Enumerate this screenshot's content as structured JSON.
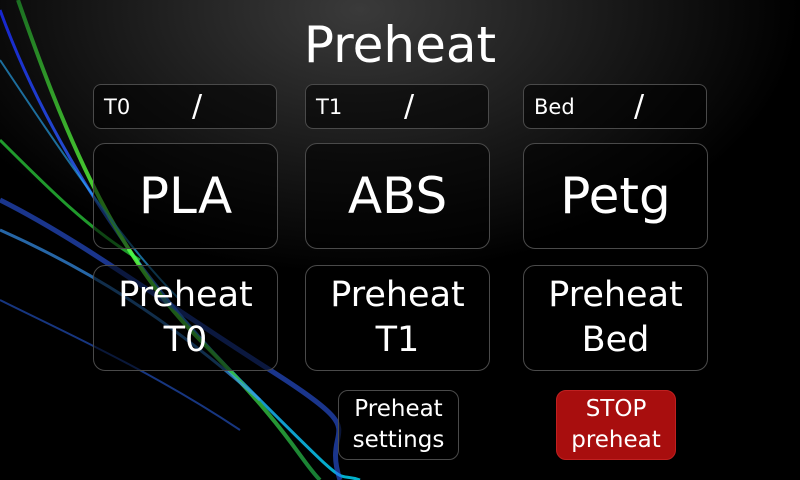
{
  "title": "Preheat",
  "status": [
    {
      "label": "T0",
      "slash": "/"
    },
    {
      "label": "T1",
      "slash": "/"
    },
    {
      "label": "Bed",
      "slash": "/"
    }
  ],
  "materials": [
    "PLA",
    "ABS",
    "Petg"
  ],
  "preheat_buttons": [
    {
      "line1": "Preheat",
      "line2": "T0"
    },
    {
      "line1": "Preheat",
      "line2": "T1"
    },
    {
      "line1": "Preheat",
      "line2": "Bed"
    }
  ],
  "settings_button": {
    "line1": "Preheat",
    "line2": "settings"
  },
  "stop_button": {
    "line1": "STOP",
    "line2": "preheat"
  },
  "colors": {
    "stop_bg": "#a80e0e",
    "border": "#4a4a4a",
    "text": "#ffffff"
  }
}
